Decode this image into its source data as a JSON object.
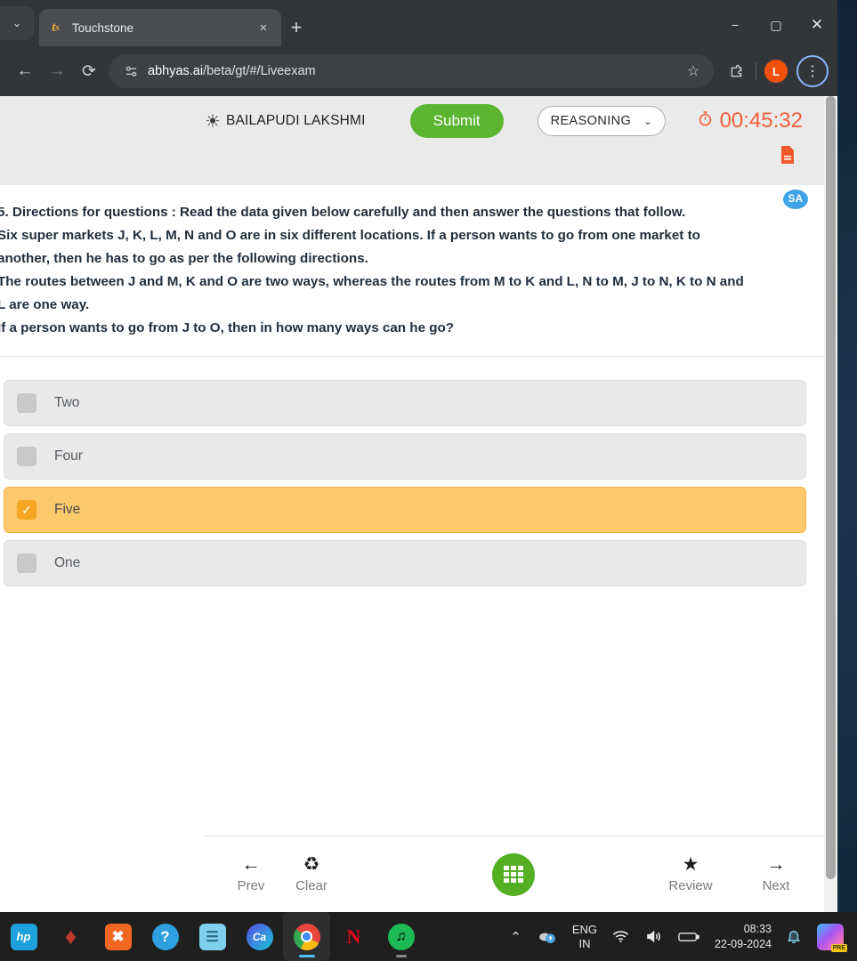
{
  "browser": {
    "tab": {
      "title": "Touchstone",
      "favicon_icon": "touchstone-favicon",
      "close_icon": "×"
    },
    "tab_search_icon": "⌄",
    "new_tab_icon": "+",
    "window_controls": {
      "minimize": "−",
      "maximize": "▢",
      "close": "✕"
    },
    "toolbar": {
      "back_icon": "←",
      "forward_icon": "→",
      "reload_icon": "⟳",
      "site_info_icon": "site-settings-icon",
      "url_domain": "abhyas.ai",
      "url_path": "/beta/gt/#/Liveexam",
      "bookmark_icon": "☆",
      "extensions_icon": "extensions-icon",
      "profile_initial": "L",
      "menu_icon": "⋮"
    }
  },
  "exam": {
    "user_name": "BAILAPUDI LAKSHMI",
    "user_icon": "person-icon",
    "submit_label": "Submit",
    "subject": "REASONING",
    "subject_chevron": "⌄",
    "timer": "00:45:32",
    "timer_icon": "⏱",
    "document_icon": "document-icon",
    "sa_badge": "SA",
    "question": {
      "number": "5.",
      "lines": [
        "5. Directions for questions : Read the data given below carefully and then answer the questions that follow.",
        "Six super markets J, K, L, M, N and O are in six different locations. If a person wants to go from one market to",
        "another, then he has to go as per the following directions.",
        "The routes between J and M, K and O are two ways, whereas the routes from M to K and L, N to M, J to N, K to N and",
        "L are one way.",
        "If a person wants to go from J to O, then in how many ways can he go?"
      ]
    },
    "options": [
      {
        "label": "Two",
        "selected": false
      },
      {
        "label": "Four",
        "selected": false
      },
      {
        "label": "Five",
        "selected": true
      },
      {
        "label": "One",
        "selected": false
      }
    ],
    "check_glyph": "✓",
    "nav": {
      "prev_icon": "←",
      "prev_label": "Prev",
      "clear_icon": "♻",
      "clear_label": "Clear",
      "grid_icon": "question-palette-icon",
      "review_icon": "★",
      "review_label": "Review",
      "next_icon": "→",
      "next_label": "Next"
    }
  },
  "taskbar": {
    "apps": [
      {
        "name": "hp-support-icon",
        "glyph": "hp",
        "color": "#1da1dc"
      },
      {
        "name": "mcafee-icon",
        "glyph": "M",
        "color": "#c0392b"
      },
      {
        "name": "xampp-icon",
        "glyph": "✖",
        "color": "#f26722"
      },
      {
        "name": "help-icon",
        "glyph": "?",
        "color": "#2e9fe0"
      },
      {
        "name": "notepad-icon",
        "glyph": "▤",
        "color": "#5ec4e8"
      },
      {
        "name": "canva-icon",
        "glyph": "C",
        "color": "#7b4fe8"
      },
      {
        "name": "chrome-icon",
        "glyph": "◉",
        "color": "#e8453c"
      },
      {
        "name": "netflix-icon",
        "glyph": "N",
        "color": "#e50914"
      },
      {
        "name": "spotify-icon",
        "glyph": "♫",
        "color": "#1db954"
      }
    ],
    "tray": {
      "chevron_icon": "⌃",
      "cloud_icon": "onedrive-icon",
      "language_top": "ENG",
      "language_bottom": "IN",
      "wifi_icon": "wifi-icon",
      "volume_icon": "volume-icon",
      "battery_icon": "battery-icon",
      "time": "08:33",
      "date": "22-09-2024",
      "bell_icon": "🔔",
      "copilot_label": "PRE"
    }
  },
  "colors": {
    "submit_green": "#5cb531",
    "timer_orange": "#f4603b",
    "selected_amber": "#fcca6d",
    "checkbox_orange": "#f6a623",
    "sa_blue": "#3fa4e8",
    "grid_green": "#54b022"
  }
}
